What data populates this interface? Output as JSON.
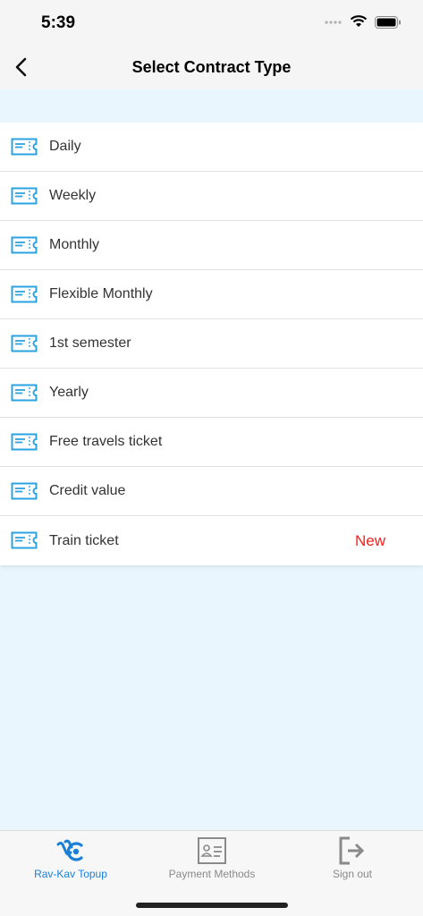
{
  "status_bar": {
    "time": "5:39"
  },
  "header": {
    "title": "Select Contract Type"
  },
  "contract_types": [
    {
      "label": "Daily",
      "badge": ""
    },
    {
      "label": "Weekly",
      "badge": ""
    },
    {
      "label": "Monthly",
      "badge": ""
    },
    {
      "label": "Flexible Monthly",
      "badge": ""
    },
    {
      "label": "1st semester",
      "badge": ""
    },
    {
      "label": "Yearly",
      "badge": ""
    },
    {
      "label": "Free travels ticket",
      "badge": ""
    },
    {
      "label": "Credit value",
      "badge": ""
    },
    {
      "label": "Train ticket",
      "badge": "New"
    }
  ],
  "tab_bar": {
    "tabs": [
      {
        "label": "Rav-Kav Topup",
        "icon": "rav-kav-icon",
        "active": true
      },
      {
        "label": "Payment Methods",
        "icon": "payment-card-icon",
        "active": false
      },
      {
        "label": "Sign out",
        "icon": "sign-out-icon",
        "active": false
      }
    ]
  },
  "colors": {
    "accent": "#1a7fd6",
    "icon_blue": "#2aa3e0",
    "new_badge": "#f2221d",
    "background": "#e9f6fd"
  }
}
